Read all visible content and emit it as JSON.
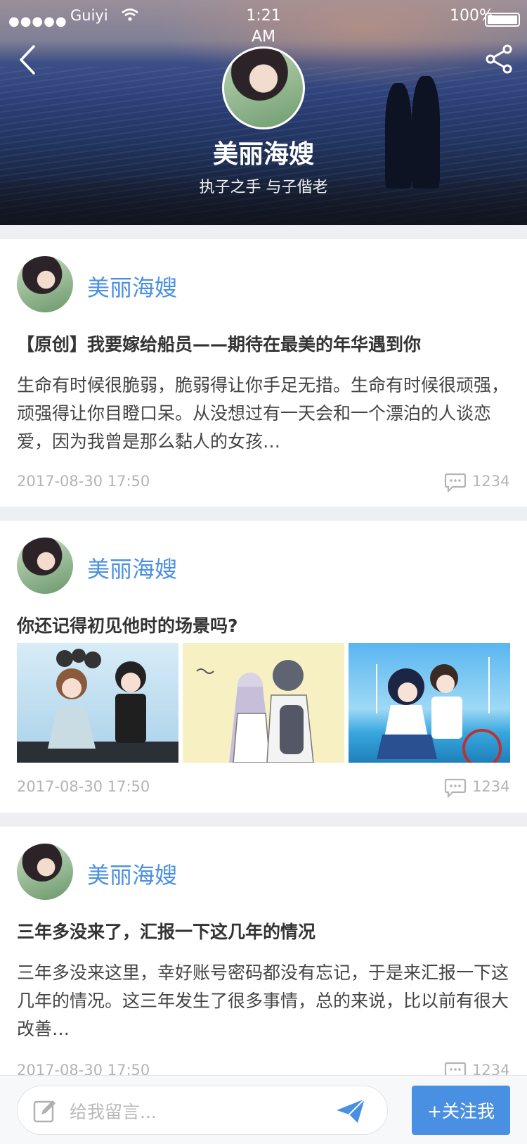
{
  "status_bar": {
    "signal": "●●●●●",
    "carrier": "Guiyi",
    "time": "1:21 AM",
    "battery": "100%"
  },
  "header": {
    "back_icon": "chevron-left-icon",
    "share_icon": "share-icon",
    "name": "美丽海嫂",
    "motto": "执子之手 与子偕老"
  },
  "posts": [
    {
      "author": "美丽海嫂",
      "title": "【原创】我要嫁给船员——期待在最美的年华遇到你",
      "excerpt": "生命有时候很脆弱，脆弱得让你手足无措。生命有时候很顽强，顽强得让你目瞪口呆。从没想过有一天会和一个漂泊的人谈恋爱，因为我曾是那么黏人的女孩…",
      "date": "2017-08-30  17:50",
      "comments": "1234"
    },
    {
      "author": "美丽海嫂",
      "title": "你还记得初见他时的场景吗?",
      "date": "2017-08-30  17:50",
      "comments": "1234"
    },
    {
      "author": "美丽海嫂",
      "title": "三年多没来了，汇报一下这几年的情况",
      "excerpt": "三年多没来这里，幸好账号密码都没有忘记，于是来汇报一下这几年的情况。这三年发生了很多事情，总的来说，比以前有很大改善…",
      "date": "2017-08-30  17:50",
      "comments": "1234"
    }
  ],
  "bottom_bar": {
    "placeholder": "给我留言...",
    "follow_label": "+关注我"
  },
  "colors": {
    "accent": "#4a90e2",
    "meta_gray": "#b4b4b4",
    "page_bg": "#eeeff3"
  }
}
